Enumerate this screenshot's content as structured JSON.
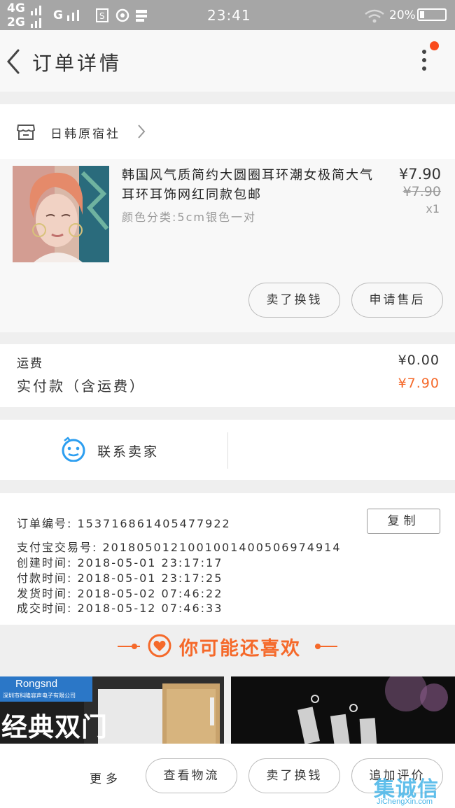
{
  "status_bar": {
    "network1": "4G",
    "network2": "2G",
    "network3": "G",
    "time": "23:41",
    "battery": "20%"
  },
  "nav": {
    "title": "订单详情"
  },
  "shop": {
    "name": "日韩原宿社"
  },
  "product": {
    "title": "韩国风气质简约大圆圈耳环潮女极简大气耳环耳饰网红同款包邮",
    "sku": "颜色分类:5cm银色一对",
    "price": "¥7.90",
    "original_price": "¥7.90",
    "quantity": "x1",
    "buttons": {
      "exchange": "卖了换钱",
      "after_sale": "申请售后"
    }
  },
  "fees": {
    "shipping_label": "运费",
    "shipping_value": "¥0.00",
    "paid_label": "实付款（含运费）",
    "paid_value": "¥7.90"
  },
  "contact": {
    "label": "联系卖家"
  },
  "order_info": {
    "order_no": "订单编号:  153716861405477922",
    "copy_label": "复制",
    "alipay_no": "支付宝交易号:  2018050121001001400506974914",
    "created": "创建时间:  2018-05-01  23:17:17",
    "paid": "付款时间:  2018-05-01  23:17:25",
    "shipped": "发货时间:  2018-05-02  07:46:22",
    "completed": "成交时间:  2018-05-12  07:46:33"
  },
  "recommend": {
    "title": "你可能还喜欢",
    "item1_brand": "Rongsnd",
    "item1_brand_sub": "深圳市科隆容声电子有限公司",
    "item1_headline": "经典双门"
  },
  "bottom_bar": {
    "more": "更多",
    "logistics": "查看物流",
    "exchange": "卖了换钱",
    "review": "追加评价"
  },
  "watermark": {
    "cn": "集诚信",
    "en": "JiChengXin.com"
  },
  "colors": {
    "accent": "#f5692a",
    "notification": "#f94b1d",
    "status_bar": "#a6a6a6"
  }
}
